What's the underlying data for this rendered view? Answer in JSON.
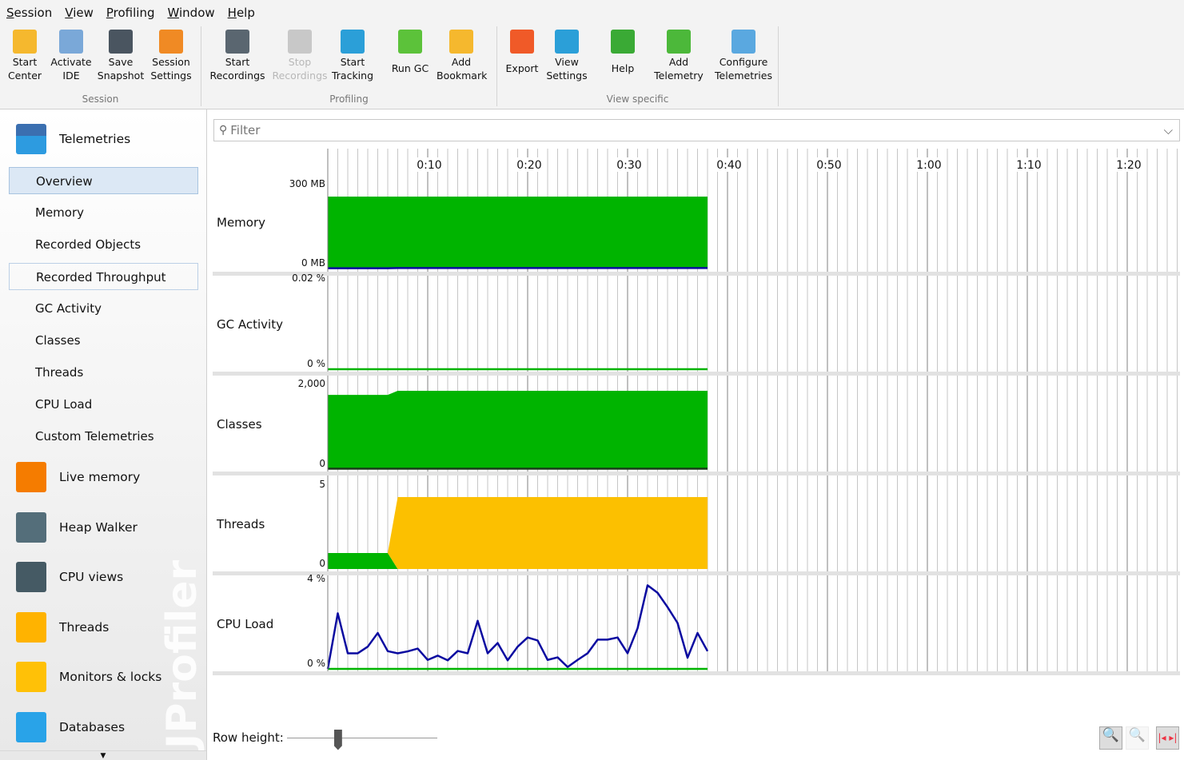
{
  "menu": [
    "Session",
    "View",
    "Profiling",
    "Window",
    "Help"
  ],
  "toolbar": {
    "groups": [
      {
        "label": "Session"
      },
      {
        "label": "Profiling"
      },
      {
        "label": "View specific"
      }
    ],
    "buttons": [
      {
        "label": "Start\nCenter",
        "icon": "start-center-icon",
        "color": "#f5b82e"
      },
      {
        "label": "Activate\nIDE",
        "icon": "activate-ide-icon",
        "color": "#7aa8d8"
      },
      {
        "label": "Save\nSnapshot",
        "icon": "save-snapshot-icon",
        "color": "#4a5560"
      },
      {
        "label": "Session\nSettings",
        "icon": "session-settings-icon",
        "color": "#f08a24"
      },
      {
        "label": "Start\nRecordings",
        "icon": "start-recordings-icon",
        "color": "#5a6670"
      },
      {
        "label": "Stop\nRecordings",
        "icon": "stop-recordings-icon",
        "color": "#c8c8c8",
        "disabled": true
      },
      {
        "label": "Start\nTracking",
        "icon": "start-tracking-icon",
        "color": "#2b9fd8"
      },
      {
        "label": "Run GC",
        "icon": "run-gc-icon",
        "color": "#5cc23a"
      },
      {
        "label": "Add\nBookmark",
        "icon": "add-bookmark-icon",
        "color": "#f5b82e"
      },
      {
        "label": "Export",
        "icon": "export-icon",
        "color": "#f05a28"
      },
      {
        "label": "View\nSettings",
        "icon": "view-settings-icon",
        "color": "#2b9fd8"
      },
      {
        "label": "Help",
        "icon": "help-icon",
        "color": "#3aaa35"
      },
      {
        "label": "Add\nTelemetry",
        "icon": "add-telemetry-icon",
        "color": "#4cb83a"
      },
      {
        "label": "Configure\nTelemetries",
        "icon": "configure-telemetries-icon",
        "color": "#5aa8e0"
      }
    ]
  },
  "sidebar": {
    "telemetries": "Telemetries",
    "items": [
      "Overview",
      "Memory",
      "Recorded Objects",
      "Recorded Throughput",
      "GC Activity",
      "Classes",
      "Threads",
      "CPU Load",
      "Custom Telemetries"
    ],
    "selected": "Overview",
    "sections": [
      {
        "label": "Live memory",
        "icon": "live-memory-icon",
        "color": "#f57c00"
      },
      {
        "label": "Heap Walker",
        "icon": "heap-walker-icon",
        "color": "#546e7a"
      },
      {
        "label": "CPU views",
        "icon": "cpu-views-icon",
        "color": "#455a64"
      },
      {
        "label": "Threads",
        "icon": "threads-icon",
        "color": "#ffb300"
      },
      {
        "label": "Monitors & locks",
        "icon": "monitors-locks-icon",
        "color": "#ffc107"
      },
      {
        "label": "Databases",
        "icon": "databases-icon",
        "color": "#29a3e8"
      }
    ],
    "watermark": "JProfiler"
  },
  "filter": {
    "placeholder": "Filter"
  },
  "chart_data": {
    "type": "area",
    "x_unit": "seconds",
    "x_ticks": [
      "0:10",
      "0:20",
      "0:30",
      "0:40",
      "0:50",
      "1:00",
      "1:10",
      "1:20"
    ],
    "xlim": [
      0,
      85
    ],
    "rows": [
      {
        "label": "Memory",
        "ymax_label": "300 MB",
        "ymin_label": "0 MB",
        "ylim": [
          0,
          300
        ],
        "series": [
          {
            "color": "#00b400",
            "kind": "area",
            "x": [
              0,
              38
            ],
            "y": [
              270,
              270
            ]
          },
          {
            "color": "#0a0aa0",
            "kind": "line",
            "x": [
              0,
              6,
              7,
              38
            ],
            "y": [
              1,
              1,
              2,
              2
            ]
          }
        ]
      },
      {
        "label": "GC Activity",
        "ymax_label": "0.02 %",
        "ymin_label": "0 %",
        "ylim": [
          0,
          0.02
        ],
        "series": [
          {
            "color": "#00b400",
            "kind": "line",
            "x": [
              0,
              38
            ],
            "y": [
              0,
              0
            ]
          }
        ]
      },
      {
        "label": "Classes",
        "ymax_label": "2,000",
        "ymin_label": "0",
        "ylim": [
          0,
          2000
        ],
        "series": [
          {
            "color": "#00b400",
            "kind": "area",
            "x": [
              0,
              6,
              7,
              38
            ],
            "y": [
              1840,
              1840,
              1940,
              1940
            ]
          },
          {
            "color": "#1a3a1a",
            "kind": "line",
            "x": [
              0,
              38
            ],
            "y": [
              10,
              10
            ]
          }
        ]
      },
      {
        "label": "Threads",
        "ymax_label": "5",
        "ymin_label": "0",
        "ylim": [
          0,
          5
        ],
        "series": [
          {
            "color": "#00b400",
            "kind": "area",
            "x": [
              0,
              6,
              7,
              38
            ],
            "y": [
              1,
              1,
              0,
              0
            ]
          },
          {
            "color": "#fcc000",
            "kind": "stacked",
            "x": [
              0,
              6,
              7,
              38
            ],
            "y": [
              0,
              0,
              4.5,
              4.5
            ]
          }
        ]
      },
      {
        "label": "CPU Load",
        "ymax_label": "4 %",
        "ymin_label": "0 %",
        "ylim": [
          0,
          4
        ],
        "series": [
          {
            "color": "#00b400",
            "kind": "line",
            "x": [
              0,
              38
            ],
            "y": [
              0,
              0
            ]
          },
          {
            "color": "#0a0aa0",
            "kind": "line",
            "x": [
              0,
              1,
              2,
              3,
              4,
              5,
              6,
              7,
              8,
              9,
              10,
              11,
              12,
              13,
              14,
              15,
              16,
              17,
              18,
              19,
              20,
              21,
              22,
              23,
              24,
              25,
              26,
              27,
              28,
              29,
              30,
              31,
              32,
              33,
              34,
              35,
              36,
              37,
              38
            ],
            "y": [
              0,
              2.6,
              0.73,
              0.73,
              1.04,
              1.68,
              0.83,
              0.73,
              0.82,
              0.95,
              0.42,
              0.62,
              0.4,
              0.84,
              0.73,
              2.25,
              0.73,
              1.21,
              0.4,
              1.04,
              1.47,
              1.33,
              0.42,
              0.54,
              0.09,
              0.42,
              0.73,
              1.37,
              1.37,
              1.47,
              0.73,
              1.9,
              3.91,
              3.56,
              2.89,
              2.15,
              0.52,
              1.68,
              0.83
            ]
          }
        ]
      }
    ]
  },
  "bottom": {
    "row_height_label": "Row height:",
    "zoom_in": "zoom-in-icon",
    "zoom_out": "zoom-out-icon",
    "fit": "fit-width-icon"
  }
}
